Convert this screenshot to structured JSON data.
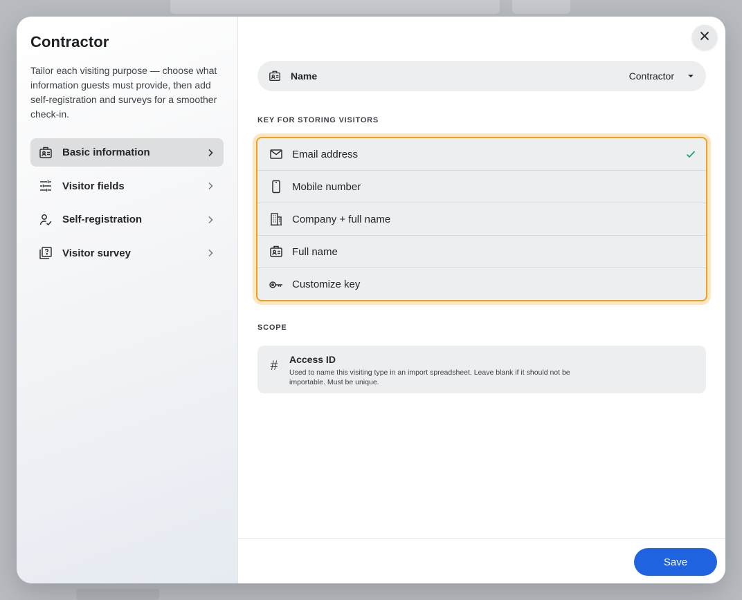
{
  "window": {
    "title": "Contractor",
    "description": "Tailor each visiting purpose — choose what information guests must provide, then add self-registration and surveys for a smoother check-in."
  },
  "sidebar": {
    "items": [
      {
        "label": "Basic information",
        "icon": "id-badge-icon",
        "active": true
      },
      {
        "label": "Visitor fields",
        "icon": "sliders-icon",
        "active": false
      },
      {
        "label": "Self-registration",
        "icon": "user-check-icon",
        "active": false
      },
      {
        "label": "Visitor survey",
        "icon": "survey-icon",
        "active": false
      }
    ]
  },
  "name_field": {
    "label": "Name",
    "value": "Contractor",
    "icon": "id-badge-icon"
  },
  "key_section": {
    "title": "KEY FOR STORING VISITORS",
    "options": [
      {
        "label": "Email address",
        "icon": "mail-icon",
        "selected": true
      },
      {
        "label": "Mobile number",
        "icon": "phone-icon",
        "selected": false
      },
      {
        "label": "Company + full name",
        "icon": "building-icon",
        "selected": false
      },
      {
        "label": "Full name",
        "icon": "id-badge-icon",
        "selected": false
      },
      {
        "label": "Customize key",
        "icon": "key-icon",
        "selected": false
      }
    ]
  },
  "scope_section": {
    "title": "SCOPE",
    "access_id": {
      "title": "Access ID",
      "description": "Used to name this visiting type in an import spreadsheet. Leave blank if it should not be importable. Must be unique.",
      "icon": "hash-icon"
    }
  },
  "footer": {
    "save_label": "Save"
  },
  "colors": {
    "accent": "#1f63e0",
    "highlight_border": "#f0a21f",
    "check": "#1aa37a"
  }
}
